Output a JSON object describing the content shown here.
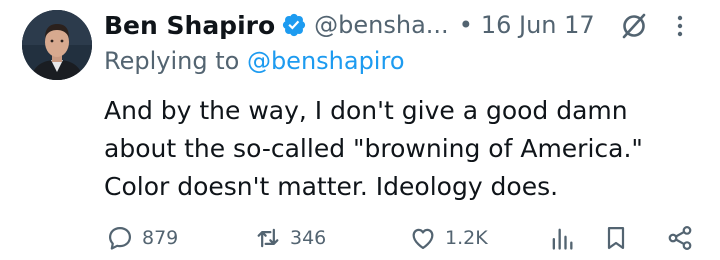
{
  "author": {
    "name": "Ben Shapiro",
    "handle": "@bensha...",
    "date": "16 Jun 17"
  },
  "reply": {
    "prefix": "Replying to ",
    "mention": "@benshapiro"
  },
  "tweet_lines": [
    "And by the way, I don't give a good damn",
    "about the so-called \"browning of America.\"",
    "Color doesn't matter. Ideology does."
  ],
  "actions": {
    "replies": "879",
    "reposts": "346",
    "likes": "1.2K"
  },
  "colors": {
    "verified": "#1d9bf0",
    "link": "#1d9bf0",
    "secondary_text": "#536471"
  }
}
